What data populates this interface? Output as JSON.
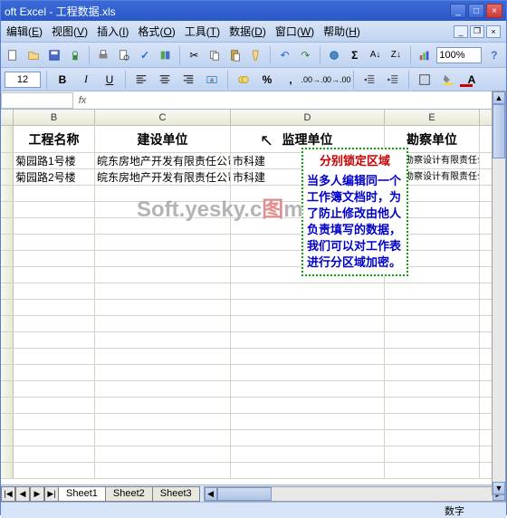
{
  "title": "oft Excel - 工程数据.xls",
  "menus": [
    {
      "label": "编辑",
      "hot": "E"
    },
    {
      "label": "视图",
      "hot": "V"
    },
    {
      "label": "插入",
      "hot": "I"
    },
    {
      "label": "格式",
      "hot": "O"
    },
    {
      "label": "工具",
      "hot": "T"
    },
    {
      "label": "数据",
      "hot": "D"
    },
    {
      "label": "窗口",
      "hot": "W"
    },
    {
      "label": "帮助",
      "hot": "H"
    }
  ],
  "zoom": "100%",
  "font_size": "12",
  "columns": [
    "B",
    "C",
    "D",
    "E"
  ],
  "headers": {
    "B": "工程名称",
    "C": "建设单位",
    "D": "监理单位",
    "E": "勘察单位"
  },
  "rows": [
    {
      "B": "菊园路1号楼",
      "C": "皖东房地产开发有限责任公司",
      "D": "市科建",
      "E": "东皖勘察设计有限责任公司"
    },
    {
      "B": "菊园路2号楼",
      "C": "皖东房地产开发有限责任公司",
      "D": "市科建",
      "E": "东皖勘察设计有限责任公司"
    }
  ],
  "callout": {
    "title": "分别锁定区域",
    "body": "当多人编辑同一个工作簿文档时，为了防止修改由他人负责填写的数据，我们可以对工作表进行分区域加密。"
  },
  "sheets": [
    "Sheet1",
    "Sheet2",
    "Sheet3"
  ],
  "active_sheet": 0,
  "status": {
    "right": "数字"
  },
  "watermark": {
    "a": "Soft.yesky.c",
    "b": "图",
    "c": "m"
  },
  "icons": {
    "bold": "B",
    "italic": "I",
    "underline": "U"
  }
}
